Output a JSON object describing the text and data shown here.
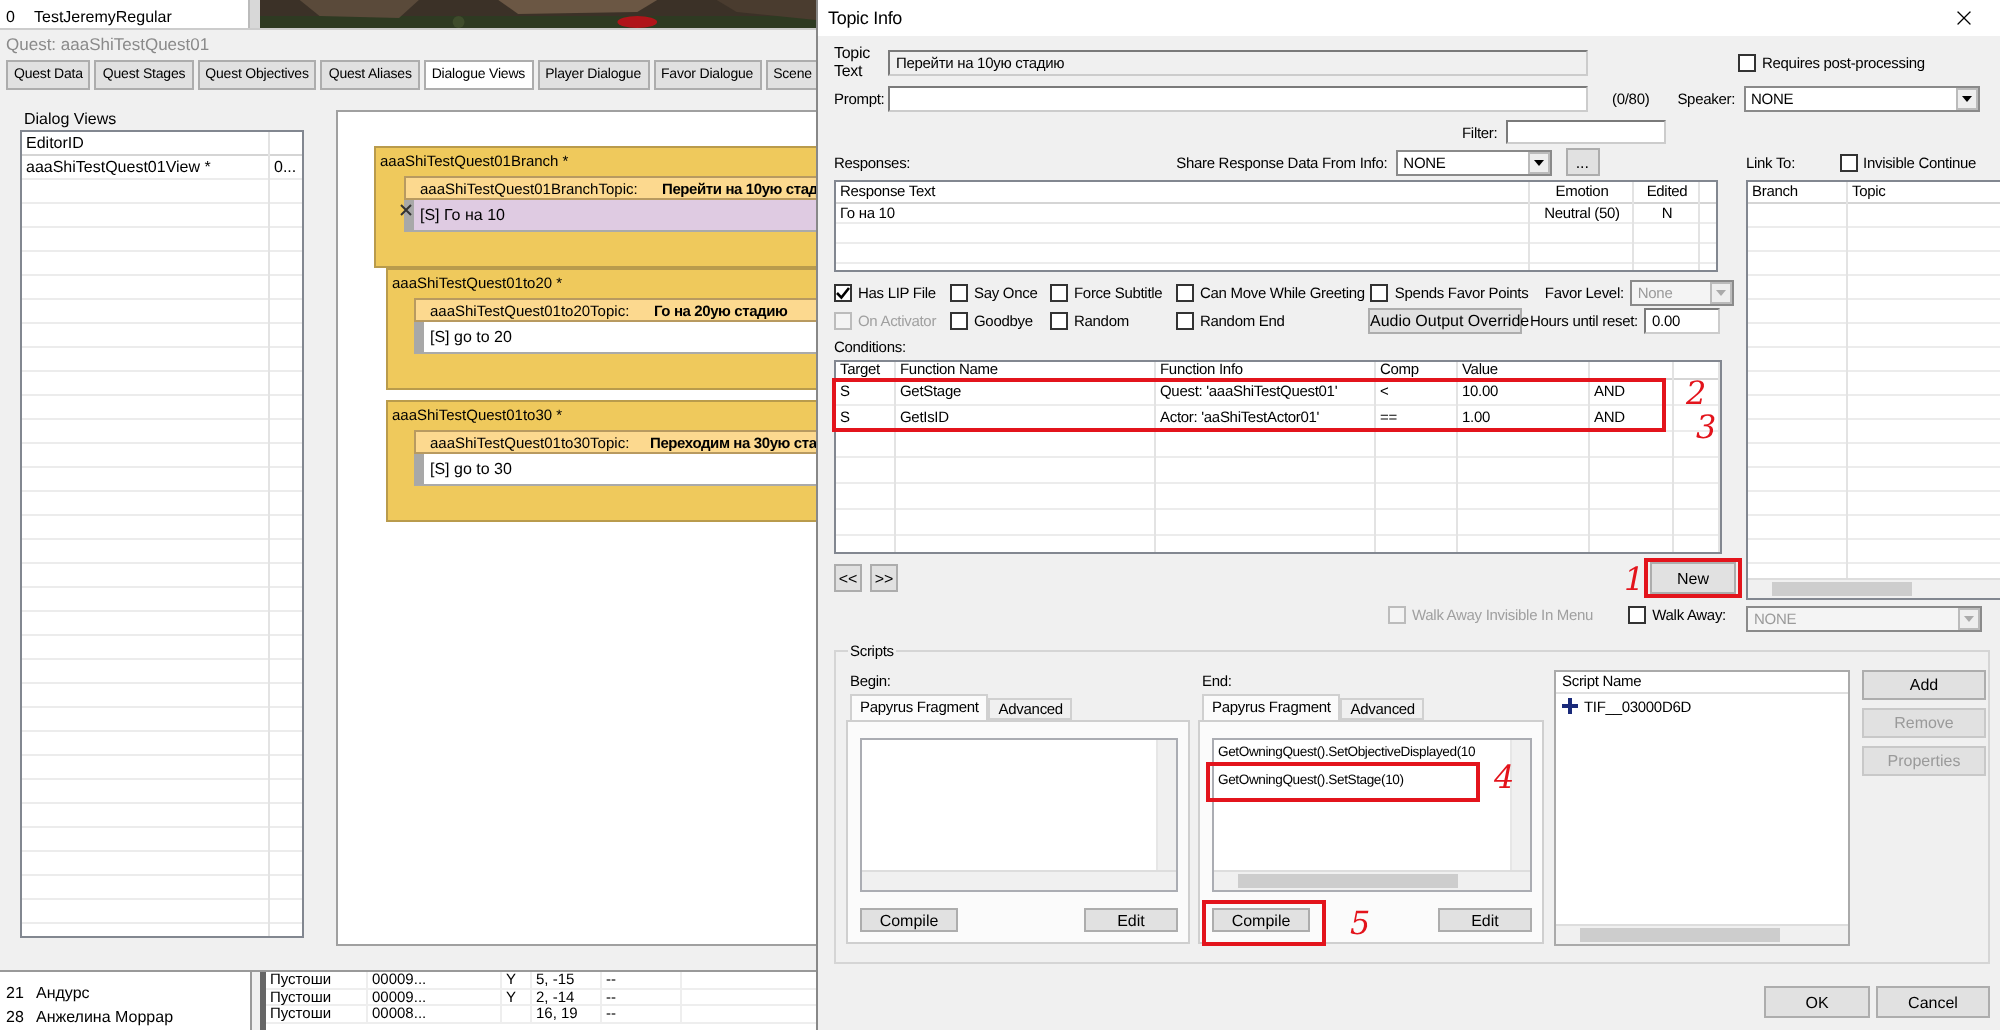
{
  "background_list": {
    "rows": [
      {
        "number": "0",
        "name": "TestJeremyRegular"
      }
    ]
  },
  "quest_window": {
    "title": "Quest: aaaShiTestQuest01",
    "tabs": [
      {
        "label": "Quest Data",
        "selected": false
      },
      {
        "label": "Quest Stages",
        "selected": false
      },
      {
        "label": "Quest Objectives",
        "selected": false
      },
      {
        "label": "Quest Aliases",
        "selected": false
      },
      {
        "label": "Dialogue Views",
        "selected": true
      },
      {
        "label": "Player Dialogue",
        "selected": false
      },
      {
        "label": "Favor Dialogue",
        "selected": false
      },
      {
        "label": "Scene",
        "selected": false
      }
    ],
    "dialog_views": {
      "label": "Dialog Views",
      "columns": [
        "EditorID"
      ],
      "rows": [
        {
          "editor_id": "aaaShiTestQuest01View *",
          "column_2": "0..."
        }
      ]
    },
    "branches": [
      {
        "title": "aaaShiTestQuest01Branch *",
        "topic_id": "aaaShiTestQuest01BranchTopic:",
        "topic_text": "Перейти на 10ую стад",
        "response": "[S] Го на 10",
        "selected": true
      },
      {
        "title": "aaaShiTestQuest01to20 *",
        "topic_id": "aaaShiTestQuest01to20Topic:",
        "topic_text": "Го на 20ую стадию",
        "response": "[S] go to 20",
        "selected": false
      },
      {
        "title": "aaaShiTestQuest01to30 *",
        "topic_id": "aaaShiTestQuest01to30Topic:",
        "topic_text": "Переходим на 30ую ста",
        "response": "[S] go to 30",
        "selected": false
      }
    ]
  },
  "background_table": {
    "names": [
      {
        "number": "21",
        "name": "Андурс"
      },
      {
        "number": "28",
        "name": "Анжелина Моррар"
      }
    ],
    "rows": [
      {
        "column_1": "Пустоши",
        "column_2": "00009...",
        "column_3": "Y",
        "column_4": "5, -15",
        "column_5": "--"
      },
      {
        "column_1": "Пустоши",
        "column_2": "00009...",
        "column_3": "Y",
        "column_4": "2, -14",
        "column_5": "--"
      },
      {
        "column_1": "Пустоши",
        "column_2": "00008...",
        "column_4": "16, 19",
        "column_5": "--"
      }
    ]
  },
  "topic_info": {
    "title": "Topic Info",
    "topic_text_label": "Topic Text",
    "topic_text": "Перейти на 10ую стадию",
    "requires_post_processing": {
      "label": "Requires post-processing",
      "checked": false
    },
    "prompt_label": "Prompt:",
    "prompt_count": "(0/80)",
    "speaker": {
      "label": "Speaker:",
      "value": "NONE"
    },
    "filter_label": "Filter:",
    "responses_label": "Responses:",
    "share": {
      "label": "Share Response Data From Info:",
      "value": "NONE",
      "button": "..."
    },
    "link_to_label": "Link To:",
    "invisible_continue": {
      "label": "Invisible Continue",
      "checked": false
    },
    "responses": {
      "columns": [
        "Response Text",
        "Emotion",
        "Edited"
      ],
      "rows": [
        {
          "response_text": "Го на 10",
          "emotion": "Neutral (50)",
          "edited": "N"
        }
      ]
    },
    "flags": [
      {
        "items": [
          {
            "label": "Has LIP File",
            "checked": true,
            "disabled": false
          },
          {
            "label": "Say Once",
            "checked": false,
            "disabled": false
          },
          {
            "label": "Force Subtitle",
            "checked": false,
            "disabled": false
          },
          {
            "label": "Can Move While Greeting",
            "checked": false,
            "disabled": false
          },
          {
            "label": "Spends Favor Points",
            "checked": false,
            "disabled": false
          }
        ]
      },
      {
        "items": [
          {
            "label": "On Activator",
            "checked": false,
            "disabled": true
          },
          {
            "label": "Goodbye",
            "checked": false,
            "disabled": false
          },
          {
            "label": "Random",
            "checked": false,
            "disabled": false
          },
          {
            "label": "Random End",
            "checked": false,
            "disabled": false
          }
        ]
      }
    ],
    "favor_level": {
      "label": "Favor Level:",
      "value": "None",
      "disabled": true
    },
    "audio_output_button": "Audio Output Override",
    "hours_until_reset": {
      "label": "Hours until reset:",
      "value": "0.00"
    },
    "conditions": {
      "label": "Conditions:",
      "columns": [
        "Target",
        "Function Name",
        "Function Info",
        "Comp",
        "Value"
      ],
      "rows": [
        {
          "target": "S",
          "function_name": "GetStage",
          "function_info": "Quest: 'aaaShiTestQuest01'",
          "comp": "<",
          "value": "10.00",
          "column_6": "AND"
        },
        {
          "target": "S",
          "function_name": "GetIsID",
          "function_info": "Actor: 'aaShiTestActor01'",
          "comp": "==",
          "value": "1.00",
          "column_6": "AND"
        }
      ],
      "annotations": [
        "2",
        "3"
      ]
    },
    "nav_buttons": [
      "<<",
      ">>"
    ],
    "new_button": {
      "label": "New",
      "annotation": "1"
    },
    "walk_away_invisible": {
      "label": "Walk Away Invisible In Menu",
      "checked": false,
      "disabled": true
    },
    "walk_away": {
      "label": "Walk Away:",
      "checked": false,
      "value": "NONE"
    },
    "link_columns": [
      "Branch",
      "Topic"
    ],
    "scripts": {
      "label": "Scripts",
      "begin": {
        "label": "Begin:",
        "tabs": [
          {
            "label": "Papyrus Fragment",
            "selected": true
          },
          {
            "label": "Advanced",
            "selected": false
          }
        ],
        "buttons": [
          "Compile",
          "Edit"
        ]
      },
      "end": {
        "label": "End:",
        "tabs": [
          {
            "label": "Papyrus Fragment",
            "selected": true
          },
          {
            "label": "Advanced",
            "selected": false
          }
        ],
        "lines": [
          "GetOwningQuest().SetObjectiveDisplayed(10",
          "GetOwningQuest().SetStage(10)"
        ],
        "buttons": [
          "Compile",
          "Edit"
        ],
        "line_annotation": "4",
        "compile_annotation": "5"
      },
      "script_list": {
        "column": "Script Name",
        "items": [
          "TIF__03000D6D"
        ]
      },
      "actions": [
        {
          "label": "Add",
          "disabled": false
        },
        {
          "label": "Remove",
          "disabled": true
        },
        {
          "label": "Properties",
          "disabled": true
        }
      ]
    },
    "dialog_buttons": [
      "OK",
      "Cancel"
    ]
  }
}
